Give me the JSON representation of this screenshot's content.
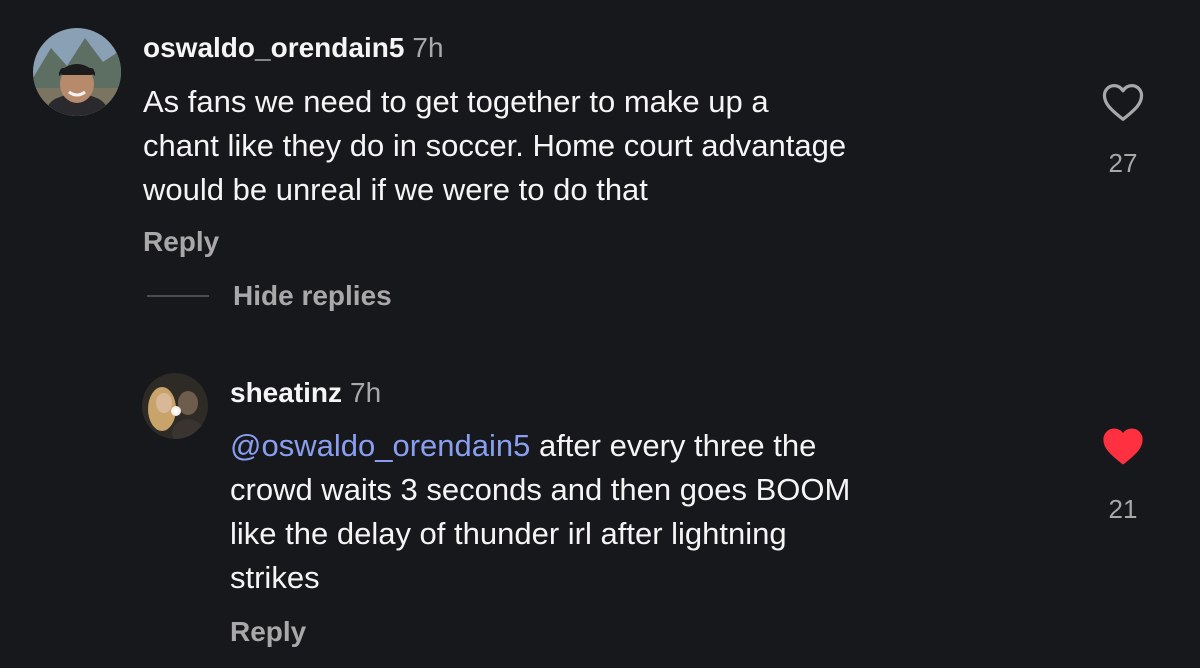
{
  "comments": [
    {
      "username": "oswaldo_orendain5",
      "time": "7h",
      "text": "As fans we need to get together to make up a\nchant like they do in soccer. Home court advantage\nwould be unreal if we were to do that",
      "reply_label": "Reply",
      "like_count": "27",
      "liked": false
    }
  ],
  "replies_toggle": {
    "label": "Hide replies"
  },
  "replies": [
    {
      "username": "sheatinz",
      "time": "7h",
      "mention": "@oswaldo_orendain5",
      "text": " after every three the\ncrowd waits 3 seconds and then goes BOOM\nlike the delay of thunder irl after lightning\nstrikes",
      "reply_label": "Reply",
      "like_count": "21",
      "liked": true
    }
  ],
  "colors": {
    "background": "#16181c",
    "text": "#f5f5f5",
    "muted": "#a8a8a8",
    "mention": "#8a9ef0",
    "like_active": "#ff3040"
  }
}
